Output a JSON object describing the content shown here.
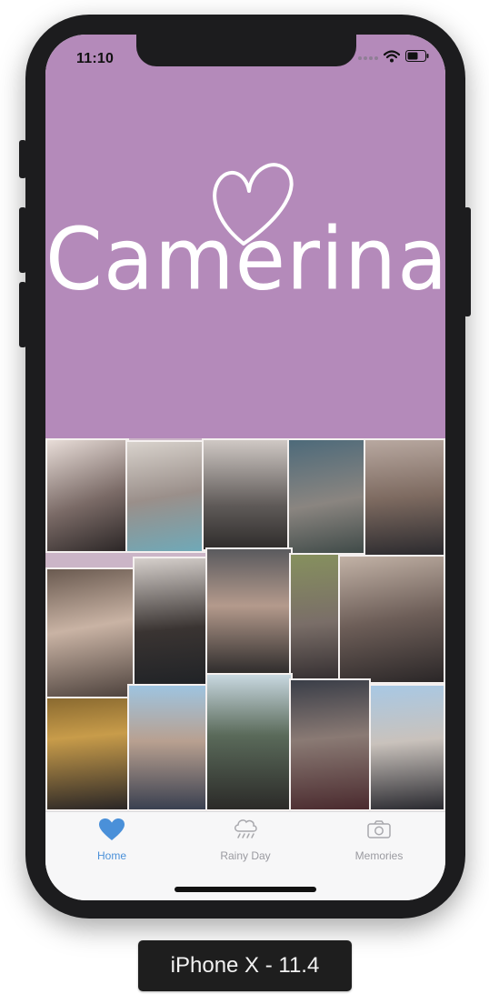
{
  "status_bar": {
    "time": "11:10"
  },
  "app": {
    "title": "Camerina",
    "hero_color": "#b48aba",
    "collage_description": "photo collage"
  },
  "tabbar": {
    "items": [
      {
        "label": "Home",
        "icon": "heart-icon",
        "active": true,
        "color": "#4a90d9"
      },
      {
        "label": "Rainy Day",
        "icon": "rain-cloud-icon",
        "active": false,
        "color": "#a8a8ad"
      },
      {
        "label": "Memories",
        "icon": "camera-icon",
        "active": false,
        "color": "#a8a8ad"
      }
    ]
  },
  "simulator": {
    "device_label": "iPhone X - 11.4"
  }
}
